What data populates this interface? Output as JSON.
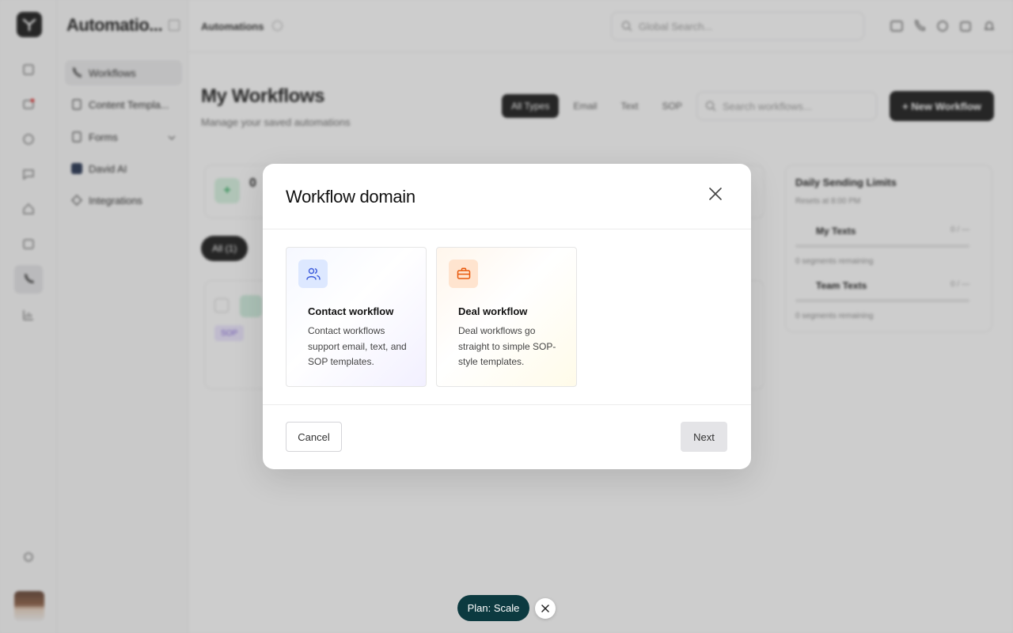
{
  "app": {
    "title": "Automations",
    "title_display": "Automatio...",
    "breadcrumb": "Automations",
    "search_placeholder": "Global Search..."
  },
  "sidebar": {
    "items": [
      {
        "label": "Workflows",
        "icon": "phone-icon",
        "active": true
      },
      {
        "label": "Content Templa...",
        "icon": "document-icon",
        "active": false
      },
      {
        "label": "Forms",
        "icon": "form-icon",
        "active": false
      },
      {
        "label": "David AI",
        "icon": "ai-icon",
        "active": false
      },
      {
        "label": "Integrations",
        "icon": "integrations-icon",
        "active": false
      }
    ]
  },
  "page": {
    "title": "My Workflows",
    "subtitle": "Manage your saved automations",
    "filters": [
      "All Types",
      "Email",
      "Text",
      "SOP"
    ],
    "search_placeholder": "Search workflows...",
    "new_button": "+ New Workflow",
    "stat_value": "0",
    "list_filter": "All (1)",
    "tag_label": "SOP"
  },
  "limits": {
    "title": "Daily Sending Limits",
    "subtitle": "Resets at 8:00 PM",
    "rows": [
      {
        "name": "My Texts",
        "value": "0 / —",
        "remaining": "0 segments remaining"
      },
      {
        "name": "Team Texts",
        "value": "0 / —",
        "remaining": "0 segments remaining"
      }
    ]
  },
  "modal": {
    "title": "Workflow domain",
    "options": [
      {
        "name": "Contact workflow",
        "description": "Contact workflows support email, text, and SOP templates.",
        "icon": "users-icon",
        "accent": "#3b5bdb"
      },
      {
        "name": "Deal workflow",
        "description": "Deal workflows go straight to simple SOP-style templates.",
        "icon": "briefcase-icon",
        "accent": "#e8590c"
      }
    ],
    "cancel_label": "Cancel",
    "next_label": "Next"
  },
  "plan_badge": {
    "label": "Plan: Scale",
    "color": "#0c3a40"
  }
}
